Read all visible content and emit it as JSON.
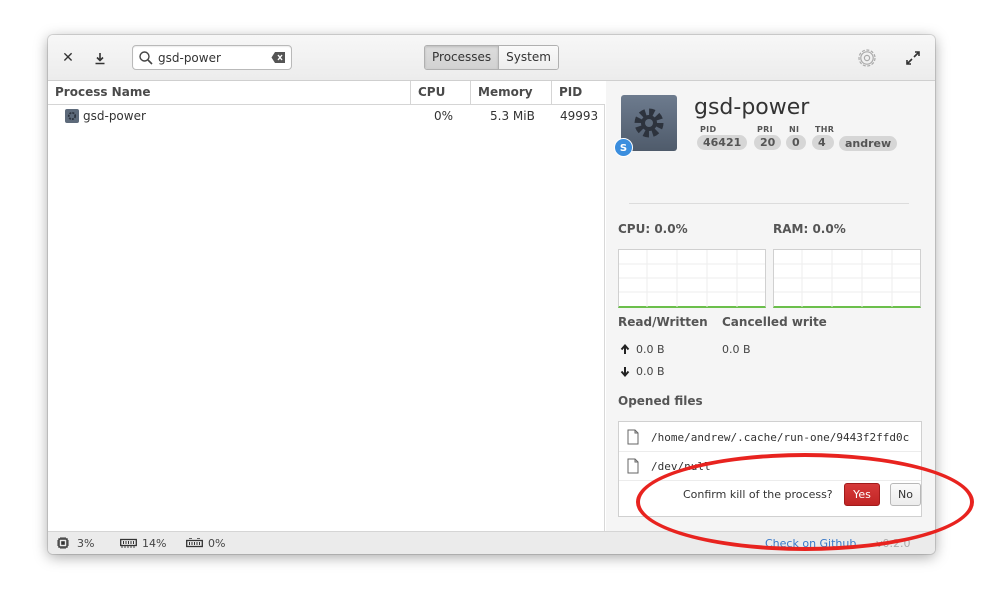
{
  "toolbar": {
    "search_value": "gsd-power",
    "mode_processes": "Processes",
    "mode_system": "System"
  },
  "table": {
    "headers": [
      "Process Name",
      "CPU",
      "Memory",
      "PID"
    ],
    "rows": [
      {
        "name": "gsd-power",
        "cpu": "0%",
        "memory": "5.3 MiB",
        "pid": "49993"
      }
    ]
  },
  "detail": {
    "name": "gsd-power",
    "badge": "S",
    "meta": [
      {
        "label": "PID",
        "value": "46421"
      },
      {
        "label": "PRI",
        "value": "20"
      },
      {
        "label": "NI",
        "value": "0"
      },
      {
        "label": "THR",
        "value": "4"
      },
      {
        "label": "",
        "value": "andrew"
      }
    ],
    "cpu_label": "CPU: 0.0%",
    "ram_label": "RAM: 0.0%",
    "read_written_title": "Read/Written",
    "cancelled_write_title": "Cancelled write",
    "read_value": "0.0 B",
    "written_value": "0.0 B",
    "cancelled_value": "0.0 B",
    "opened_files_title": "Opened files",
    "files": [
      "/home/andrew/.cache/run-one/9443f2ffd0c",
      "/dev/null"
    ]
  },
  "confirm": {
    "label": "Confirm kill of the process?",
    "yes": "Yes",
    "no": "No"
  },
  "statusbar": {
    "cpu": "3%",
    "memory": "14%",
    "swap": "0%",
    "github": "Check on Github",
    "version": "v0.2.0"
  },
  "colors": {
    "accent_red": "#c62a2a",
    "link_blue": "#3878c8",
    "graph_green": "#6bbf4b",
    "annotation_red": "#e8231f"
  }
}
